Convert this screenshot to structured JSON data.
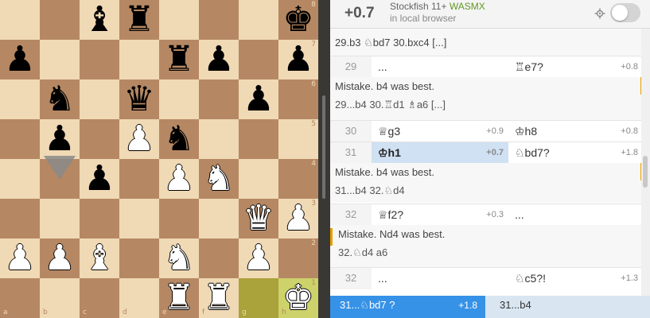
{
  "board": {
    "files": [
      "a",
      "b",
      "c",
      "d",
      "e",
      "f",
      "g",
      "h"
    ],
    "ranks": [
      "8",
      "7",
      "6",
      "5",
      "4",
      "3",
      "2",
      "1"
    ],
    "highlight": [
      "g1",
      "h1"
    ],
    "pieces": [
      {
        "sq": "c8",
        "color": "b",
        "type": "bishop",
        "glyph": "♝"
      },
      {
        "sq": "d8",
        "color": "b",
        "type": "rook",
        "glyph": "♜"
      },
      {
        "sq": "h8",
        "color": "b",
        "type": "king",
        "glyph": "♚"
      },
      {
        "sq": "a7",
        "color": "b",
        "type": "pawn",
        "glyph": "♟"
      },
      {
        "sq": "e7",
        "color": "b",
        "type": "rook",
        "glyph": "♜"
      },
      {
        "sq": "f7",
        "color": "b",
        "type": "pawn",
        "glyph": "♟"
      },
      {
        "sq": "h7",
        "color": "b",
        "type": "pawn",
        "glyph": "♟"
      },
      {
        "sq": "b6",
        "color": "b",
        "type": "knight",
        "glyph": "♞"
      },
      {
        "sq": "d6",
        "color": "b",
        "type": "queen",
        "glyph": "♛"
      },
      {
        "sq": "g6",
        "color": "b",
        "type": "pawn",
        "glyph": "♟"
      },
      {
        "sq": "b5",
        "color": "b",
        "type": "pawn",
        "glyph": "♟"
      },
      {
        "sq": "d5",
        "color": "w",
        "type": "pawn",
        "glyph": "♟"
      },
      {
        "sq": "e5",
        "color": "b",
        "type": "knight",
        "glyph": "♞"
      },
      {
        "sq": "c4",
        "color": "b",
        "type": "pawn",
        "glyph": "♟"
      },
      {
        "sq": "e4",
        "color": "w",
        "type": "pawn",
        "glyph": "♟"
      },
      {
        "sq": "f4",
        "color": "w",
        "type": "knight",
        "glyph": "♞"
      },
      {
        "sq": "g3",
        "color": "w",
        "type": "queen",
        "glyph": "♛"
      },
      {
        "sq": "h3",
        "color": "w",
        "type": "pawn",
        "glyph": "♟"
      },
      {
        "sq": "a2",
        "color": "w",
        "type": "pawn",
        "glyph": "♟"
      },
      {
        "sq": "b2",
        "color": "w",
        "type": "pawn",
        "glyph": "♟"
      },
      {
        "sq": "c2",
        "color": "w",
        "type": "bishop",
        "glyph": "♝"
      },
      {
        "sq": "e2",
        "color": "w",
        "type": "knight",
        "glyph": "♞"
      },
      {
        "sq": "g2",
        "color": "w",
        "type": "pawn",
        "glyph": "♟"
      },
      {
        "sq": "e1",
        "color": "w",
        "type": "rook",
        "glyph": "♜"
      },
      {
        "sq": "f1",
        "color": "w",
        "type": "rook",
        "glyph": "♜"
      },
      {
        "sq": "h1",
        "color": "w",
        "type": "king",
        "glyph": "♚"
      }
    ],
    "colors": {
      "light": "#f0d9b5",
      "dark": "#b58863",
      "highlight_light": "#cdd26a",
      "highlight_dark": "#aaa23a",
      "hint_arrow": "#8a8a8a"
    }
  },
  "ceval": {
    "eval": "+0.7",
    "engine": "Stockfish 11+",
    "tech": "WASMX",
    "subtitle": "in local browser",
    "settings_icon": "settings-icon",
    "toggle_on": false
  },
  "moves": {
    "top_variation": "29.b3 ♘bd7 30.bxc4 [...]",
    "row29": {
      "idx": "29",
      "white": "...",
      "black": "♖e7?",
      "black_eval": "+0.8"
    },
    "comment1": {
      "text": "Mistake. b4 was best.",
      "variation": "29...b4 30.♖d1 ♗a6 [...]"
    },
    "row30": {
      "idx": "30",
      "white": "♕g3",
      "white_eval": "+0.9",
      "black": "♔h8",
      "black_eval": "+0.8"
    },
    "row31": {
      "idx": "31",
      "white": "♔h1",
      "white_eval": "+0.7",
      "black": "♘bd7?",
      "black_eval": "+1.8"
    },
    "comment2": {
      "text": "Mistake. b4 was best.",
      "variation": "31...b4 32.♘d4"
    },
    "row32a": {
      "idx": "32",
      "white": "♕f2?",
      "white_eval": "+0.3",
      "black": "..."
    },
    "comment3": {
      "text": "Mistake. Nd4 was best.",
      "variation": "32.♘d4 a6"
    },
    "row32b": {
      "idx": "32",
      "white": "...",
      "black": "♘c5?!",
      "black_eval": "+1.3"
    }
  },
  "bottom": {
    "move1": "31...♘bd7 ?",
    "move1_eval": "+1.8",
    "move2": "31...b4"
  }
}
